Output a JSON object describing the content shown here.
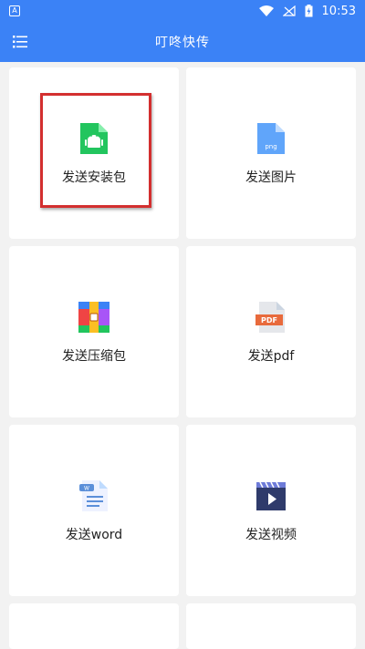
{
  "status_bar": {
    "app_icon_letter": "A",
    "time": "10:53",
    "icons": [
      "wifi-icon",
      "no-signal-icon",
      "battery-charging-icon"
    ]
  },
  "app_bar": {
    "title": "叮咚快传",
    "menu_icon": "list-menu-icon"
  },
  "cards": [
    {
      "label": "发送安装包",
      "icon": "apk-file-icon",
      "color": "#22c55e"
    },
    {
      "label": "发送图片",
      "icon": "png-file-icon",
      "color": "#60a5fa"
    },
    {
      "label": "发送压缩包",
      "icon": "archive-icon",
      "color": "#f59e0b"
    },
    {
      "label": "发送pdf",
      "icon": "pdf-file-icon",
      "color": "#e86a3c"
    },
    {
      "label": "发送word",
      "icon": "word-file-icon",
      "color": "#5b8fd9"
    },
    {
      "label": "发送视频",
      "icon": "video-icon",
      "color": "#2f3b6b"
    }
  ],
  "colors": {
    "primary": "#3b82f6",
    "highlight": "#d32f2f",
    "background": "#f2f2f2"
  }
}
